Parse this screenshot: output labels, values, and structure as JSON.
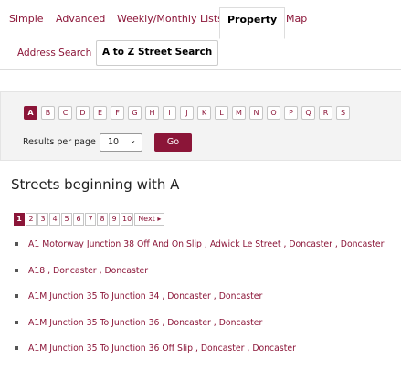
{
  "tabs": [
    {
      "label": "Simple"
    },
    {
      "label": "Advanced"
    },
    {
      "label": "Weekly/Monthly Lists"
    },
    {
      "label": "Property"
    },
    {
      "label": "Map"
    }
  ],
  "subtabs": [
    {
      "label": "Address Search"
    },
    {
      "label": "A to Z Street Search"
    }
  ],
  "letters": [
    "A",
    "B",
    "C",
    "D",
    "E",
    "F",
    "G",
    "H",
    "I",
    "J",
    "K",
    "L",
    "M",
    "N",
    "O",
    "P",
    "Q",
    "R",
    "S"
  ],
  "active_letter": "A",
  "results_per_page": {
    "label": "Results per page",
    "value": "10"
  },
  "go_label": "Go",
  "heading": "Streets beginning with A",
  "pages": [
    "1",
    "2",
    "3",
    "4",
    "5",
    "6",
    "7",
    "8",
    "9",
    "10"
  ],
  "next_label": "Next ▸",
  "streets": [
    "A1 Motorway Junction 38 Off And On Slip , Adwick Le Street , Doncaster , Doncaster",
    "A18 , Doncaster , Doncaster",
    "A1M Junction 35 To Junction 34 , Doncaster , Doncaster",
    "A1M Junction 35 To Junction 36 , Doncaster , Doncaster",
    "A1M Junction 35 To Junction 36 Off Slip , Doncaster , Doncaster"
  ],
  "colors": {
    "accent": "#8b1538",
    "panel": "#f3f3f3"
  }
}
